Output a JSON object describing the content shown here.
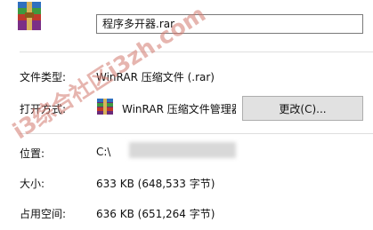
{
  "file": {
    "name": "程序多开器.rar"
  },
  "type_row": {
    "label": "文件类型:",
    "value": "WinRAR 压缩文件 (.rar)"
  },
  "open_with": {
    "label": "打开方式:",
    "app": "WinRAR 压缩文件管理器",
    "change_label": "更改(C)..."
  },
  "location": {
    "label": "位置:",
    "value": "C:\\"
  },
  "size": {
    "label": "大小:",
    "value": "633 KB (648,533 字节)"
  },
  "size_on_disk": {
    "label": "占用空间:",
    "value": "636 KB (651,264 字节)"
  },
  "icons": {
    "archive": "winrar-archive-icon",
    "app": "winrar-app-icon"
  },
  "watermark": {
    "text": "i3综合社区i3zh.com"
  }
}
